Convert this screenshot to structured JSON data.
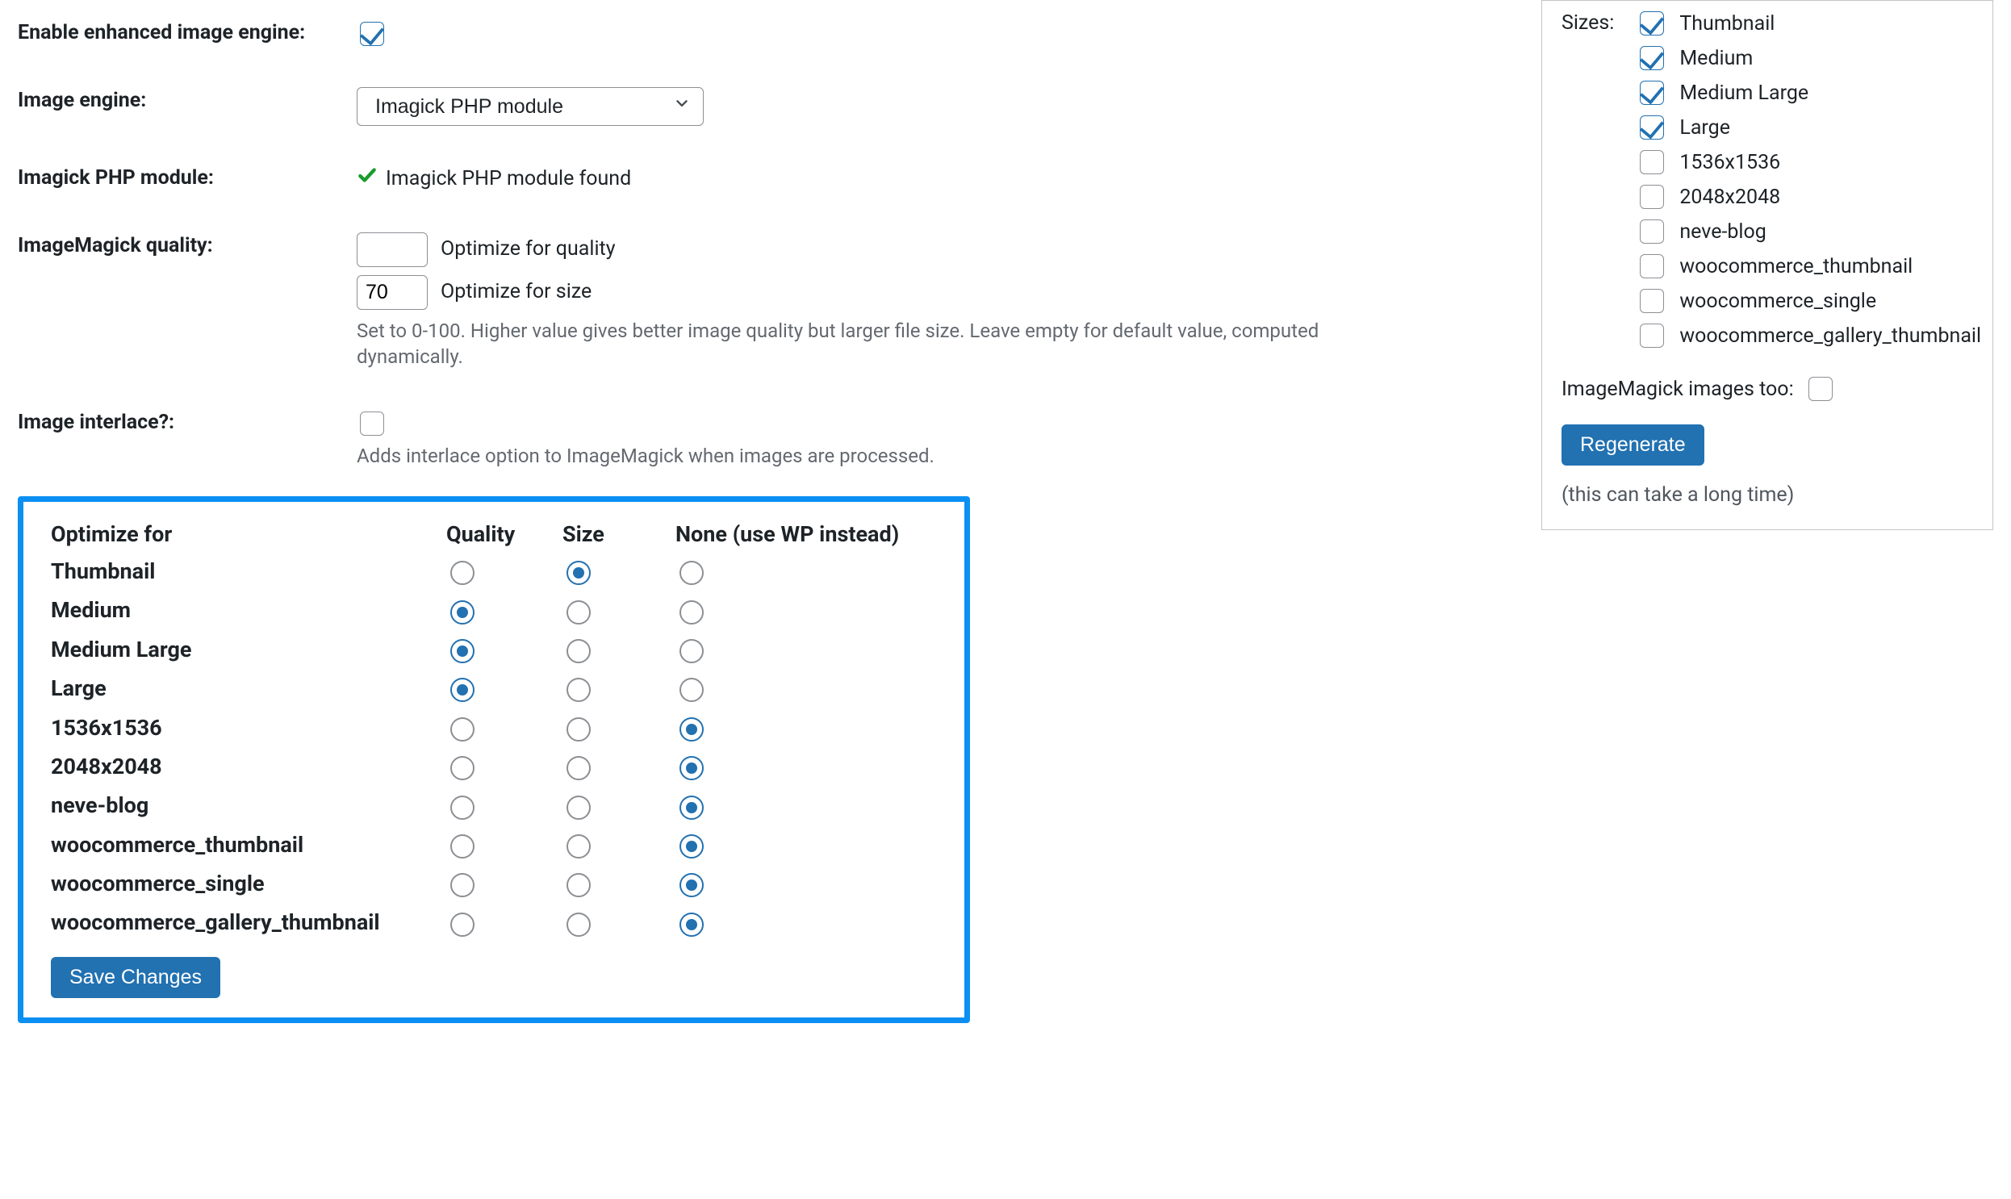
{
  "main": {
    "enable_engine": {
      "label": "Enable enhanced image engine:",
      "checked": true
    },
    "image_engine": {
      "label": "Image engine:",
      "selected": "Imagick PHP module"
    },
    "module_status": {
      "label": "Imagick PHP module:",
      "text": "Imagick PHP module found"
    },
    "quality": {
      "label": "ImageMagick quality:",
      "row_quality_label": "Optimize for quality",
      "row_size_label": "Optimize for size",
      "quality_value": "",
      "size_value": "70",
      "help": "Set to 0-100. Higher value gives better image quality but larger file size. Leave empty for default value, computed dynamically."
    },
    "interlace": {
      "label": "Image interlace?:",
      "checked": false,
      "help": "Adds interlace option to ImageMagick when images are processed."
    }
  },
  "optimize": {
    "headers": {
      "opt": "Optimize for",
      "quality": "Quality",
      "size": "Size",
      "none": "None (use WP instead)"
    },
    "rows": [
      {
        "name": "Thumbnail",
        "sel": "size"
      },
      {
        "name": "Medium",
        "sel": "quality"
      },
      {
        "name": "Medium Large",
        "sel": "quality"
      },
      {
        "name": "Large",
        "sel": "quality"
      },
      {
        "name": "1536x1536",
        "sel": "none"
      },
      {
        "name": "2048x2048",
        "sel": "none"
      },
      {
        "name": "neve-blog",
        "sel": "none"
      },
      {
        "name": "woocommerce_thumbnail",
        "sel": "none"
      },
      {
        "name": "woocommerce_single",
        "sel": "none"
      },
      {
        "name": "woocommerce_gallery_thumbnail",
        "sel": "none"
      }
    ],
    "save_label": "Save Changes"
  },
  "sidebar": {
    "sizes_label": "Sizes:",
    "items": [
      {
        "label": "Thumbnail",
        "checked": true
      },
      {
        "label": "Medium",
        "checked": true
      },
      {
        "label": "Medium Large",
        "checked": true
      },
      {
        "label": "Large",
        "checked": true
      },
      {
        "label": "1536x1536",
        "checked": false
      },
      {
        "label": "2048x2048",
        "checked": false
      },
      {
        "label": "neve-blog",
        "checked": false
      },
      {
        "label": "woocommerce_thumbnail",
        "checked": false
      },
      {
        "label": "woocommerce_single",
        "checked": false
      },
      {
        "label": "woocommerce_gallery_thumbnail",
        "checked": false
      }
    ],
    "too_label": "ImageMagick images too:",
    "too_checked": false,
    "regenerate_label": "Regenerate",
    "note": "(this can take a long time)"
  }
}
